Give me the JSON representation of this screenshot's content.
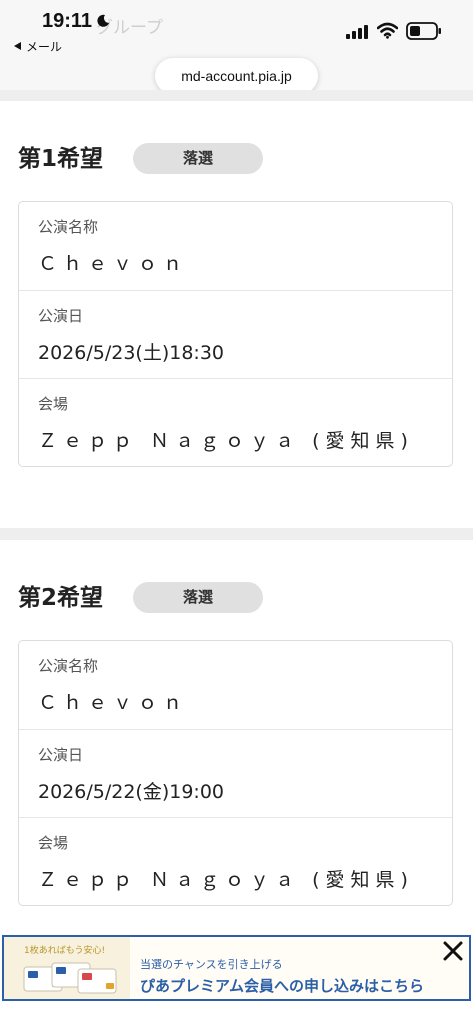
{
  "status_bar": {
    "time": "19:11",
    "ghost_title": "グループ",
    "back_label": "メール",
    "url": "md-account.pia.jp"
  },
  "choices": [
    {
      "title": "第1希望",
      "status": "落選",
      "rows": [
        {
          "label": "公演名称",
          "value": "Ｃｈｅｖｏｎ"
        },
        {
          "label": "公演日",
          "value": "2026/5/23(土)18:30"
        },
        {
          "label": "会場",
          "value": "Ｚｅｐｐ Ｎａｇｏｙａ (愛知県)"
        }
      ]
    },
    {
      "title": "第2希望",
      "status": "落選",
      "rows": [
        {
          "label": "公演名称",
          "value": "Ｃｈｅｖｏｎ"
        },
        {
          "label": "公演日",
          "value": "2026/5/22(金)19:00"
        },
        {
          "label": "会場",
          "value": "Ｚｅｐｐ Ｎａｇｏｙａ (愛知県)"
        }
      ]
    }
  ],
  "ad": {
    "tagline": "1枚あればもう安心!",
    "line1": "当選のチャンスを引き上げる",
    "line2": "ぴあプレミアム会員への申し込みはこちら",
    "accent_color": "#2b5fa8",
    "close_icon": "close-icon"
  },
  "colors": {
    "badge_bg": "#e0e0e0",
    "band": "#eeeeee",
    "card_border": "#dcdcdc"
  }
}
